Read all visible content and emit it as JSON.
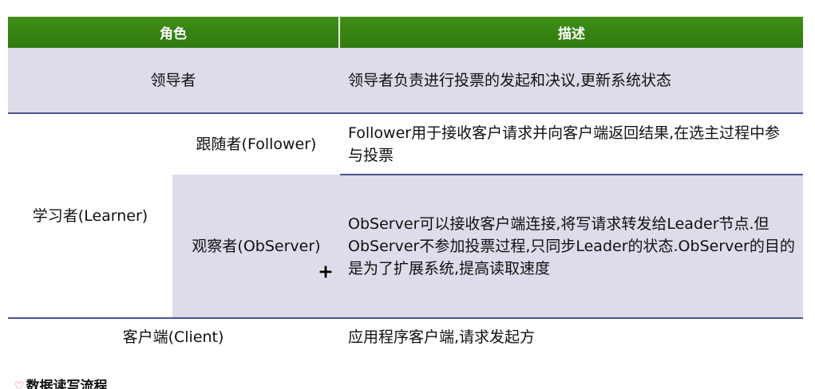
{
  "table": {
    "headers": {
      "role": "角色",
      "description": "描述"
    },
    "rows": [
      {
        "role": "领导者",
        "description": "领导者负责进行投票的发起和决议,更新系统状态"
      },
      {
        "group": "学习者(Learner)",
        "subrows": [
          {
            "role": "跟随者(Follower)",
            "description": "Follower用于接收客户请求并向客户端返回结果,在选主过程中参与投票"
          },
          {
            "role": "观察者(ObServer)",
            "description": "ObServer可以接收客户端连接,将写请求转发给Leader节点.但ObServer不参加投票过程,只同步Leader的状态.ObServer的目的是为了扩展系统,提高读取速度"
          }
        ]
      },
      {
        "role": "客户端(Client)",
        "description": "应用程序客户端,请求发起方"
      }
    ]
  },
  "footer": {
    "heading": "数据读写流程",
    "icon": "heart-icon"
  },
  "colors": {
    "header_green": "#3a8a14",
    "row_shade": "#dcdcea",
    "rule": "#4a5290"
  }
}
